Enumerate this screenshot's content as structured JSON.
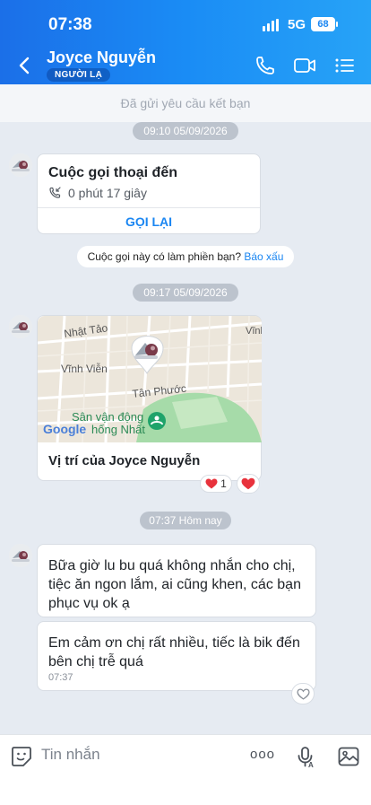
{
  "status_bar": {
    "time": "07:38",
    "network": "5G",
    "battery": "68"
  },
  "header": {
    "name": "Joyce Nguyễn",
    "badge": "NGƯỜI LẠ"
  },
  "friend_request": {
    "text": "Đã gửi yêu cầu kết bạn"
  },
  "messages": {
    "time_1": "09:10 05/09/2026",
    "call": {
      "title": "Cuộc gọi thoại đến",
      "duration": "0 phút 17 giây",
      "callback_label": "GỌI LẠI"
    },
    "notice": {
      "question": "Cuộc gọi này có làm phiền bạn?",
      "report_label": "Báo xấu"
    },
    "time_2": "09:17 05/09/2026",
    "location": {
      "caption": "Vị trí của Joyce Nguyễn",
      "map_labels": {
        "street_1": "Nhật Tảo",
        "street_2": "Vĩnh Viễn",
        "street_3": "Tân Phước",
        "street_4": "Vĩnh",
        "place": "Sân vận động",
        "place_2": "hống Nhất",
        "google": "Google"
      },
      "reaction_count": "1"
    },
    "time_3": "07:37 Hôm nay",
    "text_1": "Bữa giờ lu bu quá không nhắn cho chị, tiệc ăn ngon lắm, ai cũng khen, các bạn phục vụ ok ạ",
    "text_2": "Em cảm ơn chị rất nhiều, tiếc là bik đến bên chị trễ quá",
    "text_2_time": "07:37"
  },
  "composer": {
    "placeholder": "Tin nhắn",
    "more_label": "ooo"
  },
  "colors": {
    "accent": "#1a86f2",
    "header_start": "#1b6fe8",
    "header_end": "#27a3f7",
    "background": "#e6ebf2"
  }
}
